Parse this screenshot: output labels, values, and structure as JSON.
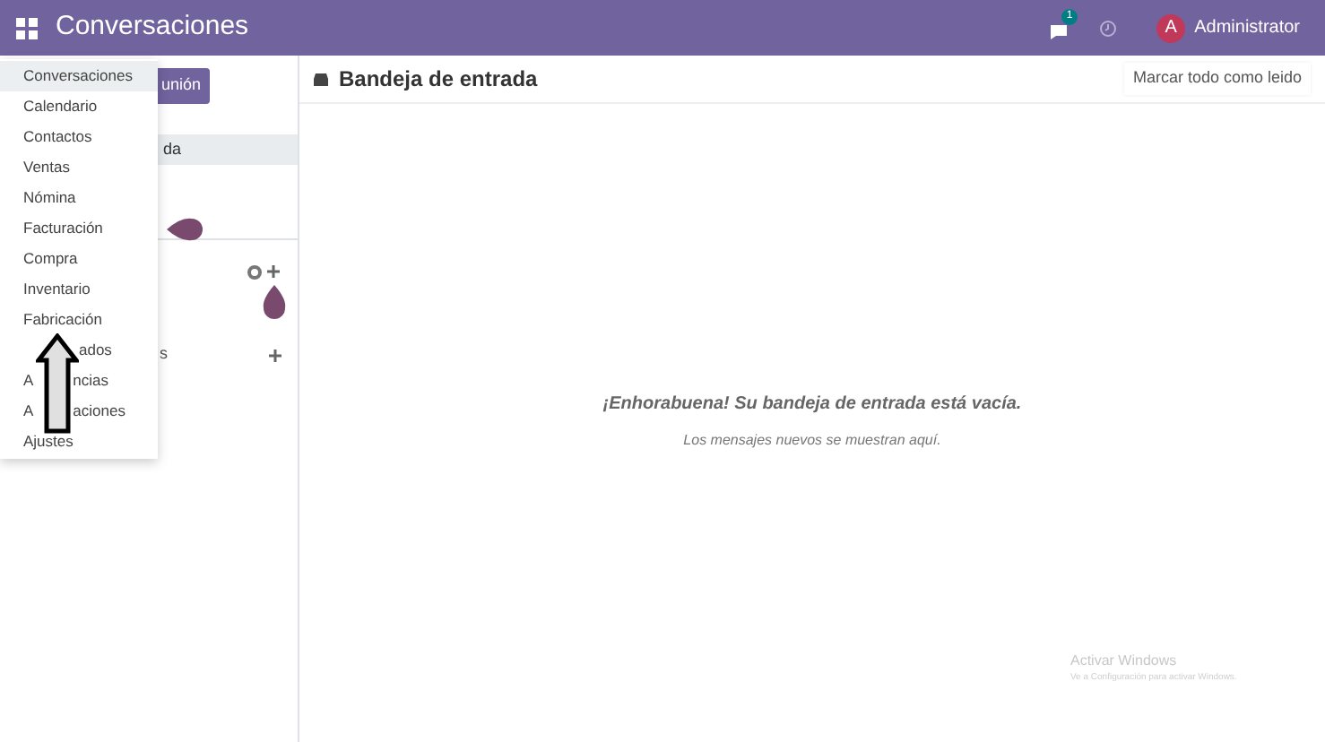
{
  "topbar": {
    "title": "Conversaciones",
    "chat_badge": "1",
    "user_initial": "A",
    "user_name": "Administrator"
  },
  "sidebar": {
    "button_fragment": "unión",
    "selected_fragment": "da",
    "section_fragment": "s"
  },
  "app_menu": [
    {
      "parts": [
        "Conversaciones"
      ],
      "selected": true
    },
    {
      "parts": [
        "Calendario"
      ],
      "selected": false
    },
    {
      "parts": [
        "Contactos"
      ],
      "selected": false
    },
    {
      "parts": [
        "Ventas"
      ],
      "selected": false
    },
    {
      "parts": [
        "Nómina"
      ],
      "selected": false
    },
    {
      "parts": [
        "Facturación"
      ],
      "selected": false
    },
    {
      "parts": [
        "Compra"
      ],
      "selected": false
    },
    {
      "parts": [
        "Inventario"
      ],
      "selected": false
    },
    {
      "parts": [
        "Fabricación"
      ],
      "selected": false
    },
    {
      "parts": [
        "ados"
      ],
      "selected": false,
      "kind": "split"
    },
    {
      "parts": [
        "A",
        "ncias"
      ],
      "selected": false,
      "kind": "split"
    },
    {
      "parts": [
        "A",
        "aciones"
      ],
      "selected": false,
      "kind": "split"
    },
    {
      "parts": [
        "Ajustes"
      ],
      "selected": false
    }
  ],
  "content": {
    "header": "Bandeja de entrada",
    "mark_all_button": "Marcar todo como leido",
    "empty_title": "¡Enhorabuena! Su bandeja de entrada está vacía.",
    "empty_subtitle": "Los mensajes nuevos se muestran aquí."
  },
  "os_notice": {
    "title": "Activar Windows",
    "subtitle": "Ve a Configuración para activar Windows."
  }
}
